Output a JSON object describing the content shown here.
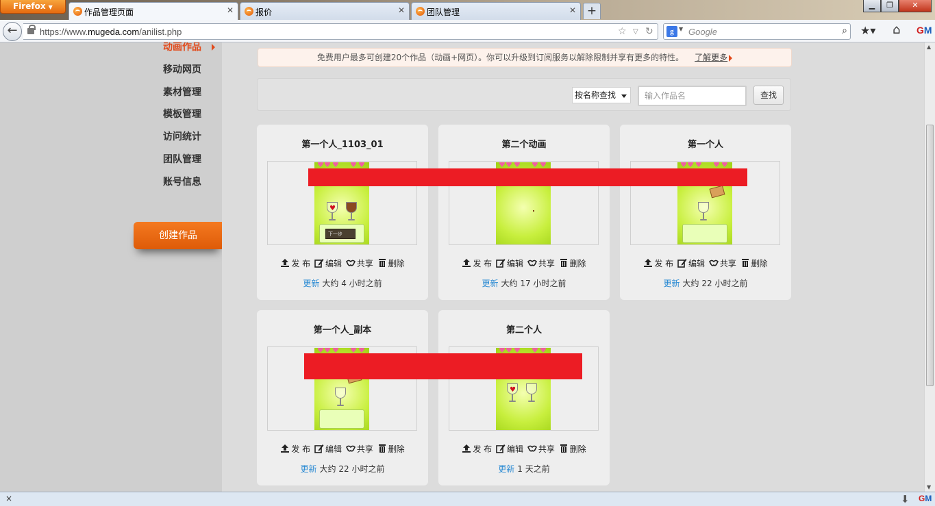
{
  "browser": {
    "app_button": "Firefox",
    "tabs": [
      {
        "title": "作品管理页面",
        "active": true
      },
      {
        "title": "报价",
        "active": false
      },
      {
        "title": "团队管理",
        "active": false
      }
    ],
    "url_prefix": "https://www.",
    "url_domain": "mugeda.com",
    "url_path": "/anilist.php",
    "search_placeholder": "Google",
    "addon_close": "×"
  },
  "sidebar": {
    "items": [
      "动画作品",
      "移动网页",
      "素材管理",
      "模板管理",
      "访问统计",
      "团队管理",
      "账号信息"
    ],
    "active_index": 0,
    "create_button": "创建作品"
  },
  "notice": {
    "text": "免费用户最多可创建20个作品（动画+网页）。你可以升级到订阅服务以解除限制并享有更多的特性。",
    "link": "了解更多"
  },
  "search": {
    "select_value": "按名称查找",
    "input_placeholder": "输入作品名",
    "button": "查找"
  },
  "card_actions": {
    "publish": "发 布",
    "edit": "编辑",
    "share": "共享",
    "delete": "删除",
    "updated_label": "更新"
  },
  "works": [
    {
      "title": "第一个人_1103_01",
      "updated": "大约 4 小时之前",
      "thumb_button": "下一步"
    },
    {
      "title": "第二个动画",
      "updated": "大约 17 小时之前"
    },
    {
      "title": "第一个人",
      "updated": "大约 22 小时之前"
    },
    {
      "title": "第一个人_副本",
      "updated": "大约 22 小时之前"
    },
    {
      "title": "第二个人",
      "updated": "1 天之前"
    }
  ],
  "colors": {
    "accent": "#e24a1b",
    "create_button": "#f47920",
    "link": "#2a8ad3",
    "redaction": "#ec1c24"
  }
}
